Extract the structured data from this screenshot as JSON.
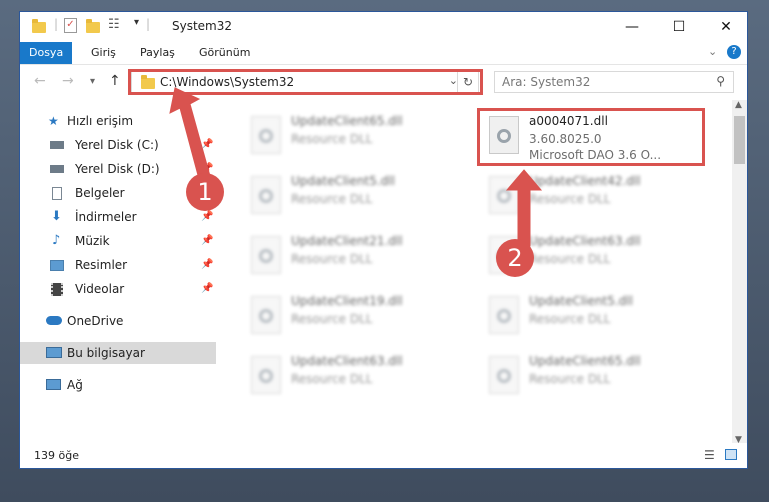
{
  "window": {
    "title": "System32"
  },
  "ribbon": {
    "tabs": [
      "Dosya",
      "Giriş",
      "Paylaş",
      "Görünüm"
    ]
  },
  "address": {
    "path": "C:\\Windows\\System32"
  },
  "search": {
    "placeholder": "Ara: System32"
  },
  "sidebar": {
    "items": [
      {
        "label": "Hızlı erişim",
        "icon": "star-icon"
      },
      {
        "label": "Yerel Disk (C:)",
        "icon": "drive-icon",
        "pinned": true
      },
      {
        "label": "Yerel Disk (D:)",
        "icon": "drive-icon",
        "pinned": true
      },
      {
        "label": "Belgeler",
        "icon": "documents-icon",
        "pinned": true
      },
      {
        "label": "İndirmeler",
        "icon": "download-icon",
        "pinned": true
      },
      {
        "label": "Müzik",
        "icon": "music-icon",
        "pinned": true
      },
      {
        "label": "Resimler",
        "icon": "pictures-icon",
        "pinned": true
      },
      {
        "label": "Videolar",
        "icon": "videos-icon",
        "pinned": true
      },
      {
        "label": "OneDrive",
        "icon": "cloud-icon"
      },
      {
        "label": "Bu bilgisayar",
        "icon": "computer-icon",
        "selected": true
      },
      {
        "label": "Ağ",
        "icon": "network-icon"
      }
    ]
  },
  "files": [
    {
      "name": "UpdateClient65.dll",
      "sub": "Resource DLL"
    },
    {
      "name": "a0004071.dll",
      "sub": "3.60.8025.0",
      "sub2": "Microsoft DAO 3.6 O..."
    },
    {
      "name": "UpdateClient5.dll",
      "sub": "Resource DLL"
    },
    {
      "name": "UpdateClient42.dll",
      "sub": "Resource DLL"
    },
    {
      "name": "UpdateClient21.dll",
      "sub": "Resource DLL"
    },
    {
      "name": "UpdateClient63.dll",
      "sub": "Resource DLL"
    },
    {
      "name": "UpdateClient19.dll",
      "sub": "Resource DLL"
    },
    {
      "name": "UpdateClient5.dll",
      "sub": "Resource DLL"
    },
    {
      "name": "UpdateClient63.dll",
      "sub": "Resource DLL"
    },
    {
      "name": "UpdateClient65.dll",
      "sub": "Resource DLL"
    }
  ],
  "status": {
    "count": "139 öğe"
  },
  "annotations": {
    "step1": "1",
    "step2": "2",
    "color": "#d9534f"
  }
}
